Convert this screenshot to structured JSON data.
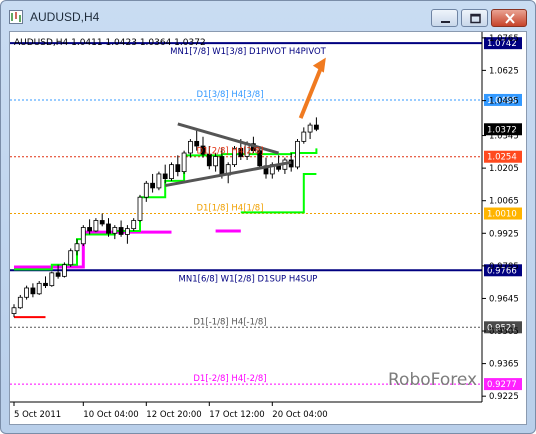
{
  "window": {
    "title": "AUDUSD,H4",
    "controls": {
      "minimize": "minimize",
      "maximize": "maximize",
      "close": "close"
    }
  },
  "chart_data": {
    "type": "candlestick",
    "symbol_info": "AUDUSD,H4  1.0411 1.0423 1.0364 1.0372",
    "ylim": [
      0.92,
      1.079
    ],
    "y_ticks": [
      "1.0765",
      "1.0625",
      "1.0495",
      "1.0345",
      "1.0205",
      "1.0065",
      "0.9925",
      "0.9785",
      "0.9645",
      "0.9505",
      "0.9365",
      "0.9225"
    ],
    "x_ticks": [
      "5 Oct 2011",
      "10 Oct 04:00",
      "12 Oct 20:00",
      "17 Oct 12:00",
      "20 Oct 04:00"
    ],
    "levels": [
      {
        "value": 1.0742,
        "label": "MN1[7/8] W1[3/8] D1PIVOT H4PIVOT",
        "price_tag": "1.0742",
        "color": "#000080",
        "style": "solid",
        "tag_bg": "#000080",
        "tag_fg": "#ffffff"
      },
      {
        "value": 1.0498,
        "label": "D1[3/8] H4[3/8]",
        "price_tag": "1.0498",
        "color": "#3399ff",
        "style": "dotted",
        "tag_bg": "#3399ff",
        "tag_fg": "#ffffff"
      },
      {
        "value": 1.0372,
        "label": "",
        "price_tag": "1.0372",
        "color": "#000000",
        "style": "none",
        "tag_bg": "#000000",
        "tag_fg": "#ffffff"
      },
      {
        "value": 1.0254,
        "label": "D1[2/8] H4[2/8]",
        "price_tag": "1.0254",
        "color": "#e03010",
        "style": "dotted",
        "tag_bg": "#ff4a1f",
        "tag_fg": "#ffffff"
      },
      {
        "value": 1.001,
        "label": "D1[1/8] H4[1/8]",
        "price_tag": "1.0010",
        "color": "#f0a000",
        "style": "dotted",
        "tag_bg": "#ffb400",
        "tag_fg": "#ffffff"
      },
      {
        "value": 0.9766,
        "label": "MN1[6/8] W1[2/8] D1SUP H4SUP",
        "price_tag": "0.9766",
        "color": "#000080",
        "style": "solid",
        "tag_bg": "#000080",
        "tag_fg": "#ffffff"
      },
      {
        "value": 0.9521,
        "label": "D1[-1/8] H4[-1/8]",
        "price_tag": "0.9521",
        "color": "#555555",
        "style": "dotted",
        "tag_bg": "#4a4a4a",
        "tag_fg": "#ffffff"
      },
      {
        "value": 0.9277,
        "label": "D1[-2/8] H4[-2/8]",
        "price_tag": "0.9277",
        "color": "#ff00ff",
        "style": "dotted",
        "tag_bg": "#ff22ff",
        "tag_fg": "#ffffff"
      }
    ],
    "candles": [
      [
        0.958,
        0.962,
        0.9565,
        0.9605
      ],
      [
        0.9605,
        0.966,
        0.96,
        0.965
      ],
      [
        0.965,
        0.97,
        0.964,
        0.969
      ],
      [
        0.969,
        0.971,
        0.965,
        0.9665
      ],
      [
        0.9665,
        0.972,
        0.966,
        0.971
      ],
      [
        0.971,
        0.974,
        0.969,
        0.97
      ],
      [
        0.97,
        0.976,
        0.9695,
        0.9755
      ],
      [
        0.9755,
        0.979,
        0.973,
        0.974
      ],
      [
        0.974,
        0.98,
        0.9735,
        0.979
      ],
      [
        0.979,
        0.986,
        0.978,
        0.985
      ],
      [
        0.985,
        0.99,
        0.983,
        0.988
      ],
      [
        0.988,
        0.996,
        0.987,
        0.995
      ],
      [
        0.995,
        0.9985,
        0.992,
        0.9935
      ],
      [
        0.9935,
        0.999,
        0.993,
        0.998
      ],
      [
        0.998,
        1.001,
        0.9955,
        0.9965
      ],
      [
        0.9965,
        0.999,
        0.991,
        0.9925
      ],
      [
        0.9925,
        0.996,
        0.99,
        0.995
      ],
      [
        0.995,
        0.998,
        0.991,
        0.992
      ],
      [
        0.992,
        0.996,
        0.988,
        0.9945
      ],
      [
        0.9945,
        0.999,
        0.9935,
        0.998
      ],
      [
        0.998,
        1.009,
        0.9975,
        1.008
      ],
      [
        1.008,
        1.015,
        1.006,
        1.014
      ],
      [
        1.014,
        1.018,
        1.01,
        1.012
      ],
      [
        1.012,
        1.019,
        1.011,
        1.018
      ],
      [
        1.018,
        1.022,
        1.014,
        1.016
      ],
      [
        1.016,
        1.023,
        1.015,
        1.022
      ],
      [
        1.022,
        1.026,
        1.017,
        1.019
      ],
      [
        1.019,
        1.028,
        1.018,
        1.027
      ],
      [
        1.027,
        1.033,
        1.025,
        1.032
      ],
      [
        1.032,
        1.037,
        1.028,
        1.03
      ],
      [
        1.03,
        1.034,
        1.025,
        1.0265
      ],
      [
        1.0265,
        1.03,
        1.02,
        1.0215
      ],
      [
        1.0215,
        1.027,
        1.019,
        1.0255
      ],
      [
        1.0255,
        1.029,
        1.016,
        1.0175
      ],
      [
        1.0175,
        1.023,
        1.014,
        1.022
      ],
      [
        1.022,
        1.03,
        1.021,
        1.029
      ],
      [
        1.029,
        1.033,
        1.024,
        1.0255
      ],
      [
        1.0255,
        1.032,
        1.024,
        1.031
      ],
      [
        1.031,
        1.034,
        1.027,
        1.028
      ],
      [
        1.028,
        1.03,
        1.02,
        1.0215
      ],
      [
        1.0215,
        1.025,
        1.016,
        1.018
      ],
      [
        1.018,
        1.023,
        1.016,
        1.022
      ],
      [
        1.022,
        1.026,
        1.019,
        1.02
      ],
      [
        1.02,
        1.025,
        1.018,
        1.024
      ],
      [
        1.024,
        1.027,
        1.019,
        1.021
      ],
      [
        1.021,
        1.033,
        1.02,
        1.032
      ],
      [
        1.032,
        1.038,
        1.031,
        1.036
      ],
      [
        1.036,
        1.04,
        1.033,
        1.039
      ],
      [
        1.039,
        1.0423,
        1.0364,
        1.0372
      ]
    ],
    "green_steps": [
      [
        0,
        0.977
      ],
      [
        5,
        0.977
      ],
      [
        6,
        0.979
      ],
      [
        10,
        0.99
      ],
      [
        11,
        0.992
      ],
      [
        16,
        0.9935
      ],
      [
        20,
        1.008
      ],
      [
        24,
        1.015
      ],
      [
        27,
        1.026
      ],
      [
        33,
        1.0265
      ],
      [
        44,
        1.027
      ],
      [
        48,
        1.029
      ]
    ],
    "red_step": [
      [
        0,
        0.9565
      ],
      [
        5,
        0.9565
      ]
    ],
    "magenta_steps": [
      [
        0,
        0.978
      ],
      [
        11,
        0.978
      ],
      [
        11,
        0.993
      ],
      [
        25,
        0.993
      ]
    ],
    "green_low": [
      [
        36,
        1.0015
      ],
      [
        44,
        1.0015
      ],
      [
        46,
        1.018
      ],
      [
        48,
        1.018
      ]
    ],
    "triangle_upper": [
      [
        26,
        1.0395
      ],
      [
        42,
        1.027
      ]
    ],
    "triangle_lower": [
      [
        24,
        1.013
      ],
      [
        44,
        1.023
      ]
    ],
    "arrow": {
      "from": [
        45.5,
        1.042
      ],
      "to": [
        49.5,
        1.068
      ],
      "color": "#f07a20"
    },
    "watermark": "RoboForex"
  }
}
